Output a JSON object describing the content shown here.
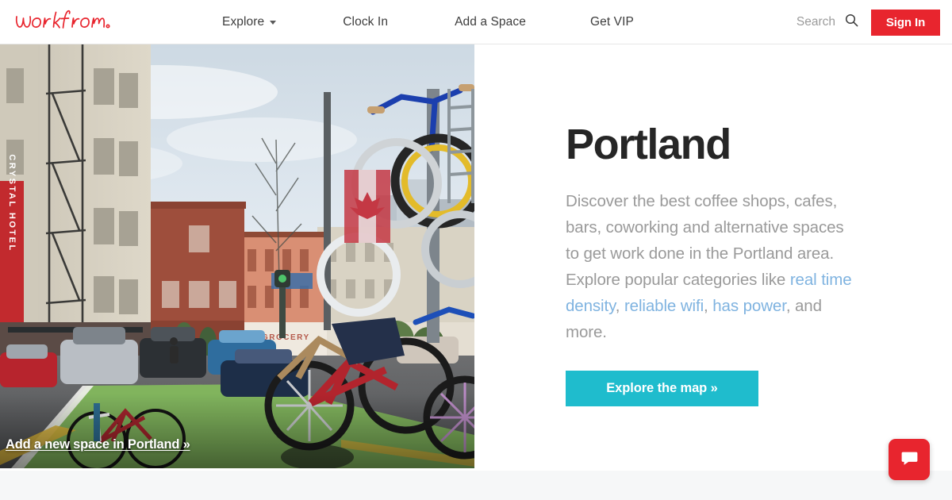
{
  "header": {
    "logo_text": "workfrom",
    "logo_icon": "workfrom-script-logo",
    "nav": [
      {
        "label": "Explore",
        "has_caret": true,
        "icon": "chevron-down-icon"
      },
      {
        "label": "Clock In",
        "has_caret": false
      },
      {
        "label": "Add a Space",
        "has_caret": false
      },
      {
        "label": "Get VIP",
        "has_caret": false
      }
    ],
    "search": {
      "label": "Search",
      "icon": "search-icon"
    },
    "signin_label": "Sign In"
  },
  "hero": {
    "photo_alt": "Portland street scene with bicycle sculpture and green bike lane",
    "photo_overlay_link": "Add a new space in Portland »",
    "signs": {
      "left_vertical": "CRYSTAL HOTEL",
      "storefront": "GROCERY"
    }
  },
  "main": {
    "title": "Portland",
    "lede_part1": "Discover the best coffee shops, cafes, bars, coworking and alternative spaces to get work done in the Portland area. Explore popular categories like ",
    "link_density": "real time density",
    "sep1": ", ",
    "link_wifi": "reliable wifi",
    "sep2": ", ",
    "link_power": "has power",
    "lede_part2": ", and more.",
    "cta_label": "Explore the map »"
  },
  "chat": {
    "icon": "chat-bubble-icon",
    "label": "Open chat"
  },
  "colors": {
    "brand_red": "#e8252e",
    "cta_teal": "#1fbccd",
    "link_blue": "#7fb3e0",
    "body_gray": "#9a9a9a",
    "title_dark": "#262626",
    "strip_gray": "#f6f7f8"
  }
}
